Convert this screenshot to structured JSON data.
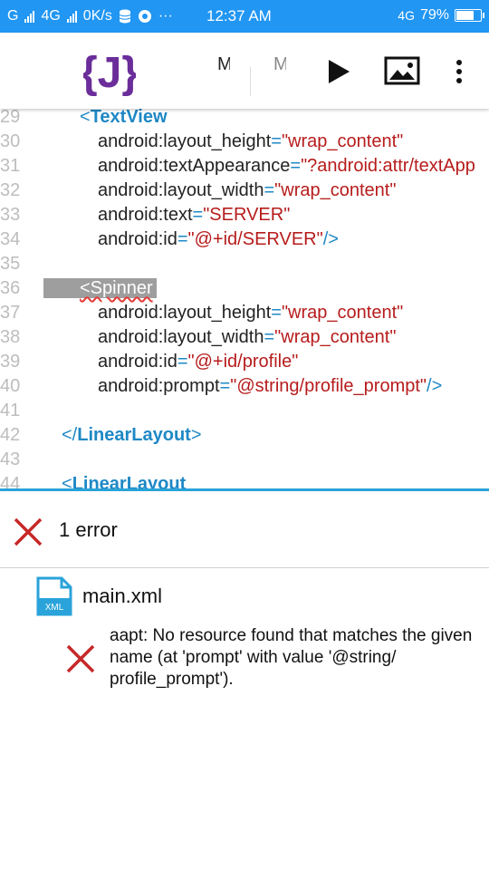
{
  "status_bar": {
    "sim1": "G",
    "sim2": "4G",
    "speed": "0K/s",
    "dots": "···",
    "time": "12:37 AM",
    "net_type": "4G",
    "battery": "79%",
    "battery_level": 0.79
  },
  "app_bar": {
    "logo_glyph": "{J}",
    "tab1": "MAIN",
    "tab2": "MAIN"
  },
  "editor": {
    "lines": [
      {
        "n": "29",
        "indent": 40,
        "parts": [
          [
            "punct",
            "<"
          ],
          [
            "tag",
            "TextView"
          ]
        ]
      },
      {
        "n": "30",
        "indent": 60,
        "parts": [
          [
            "attr",
            "android:layout_height"
          ],
          [
            "eq",
            "="
          ],
          [
            "val",
            "\"wrap_content\""
          ]
        ]
      },
      {
        "n": "31",
        "indent": 60,
        "parts": [
          [
            "attr",
            "android:textAppearance"
          ],
          [
            "eq",
            "="
          ],
          [
            "val",
            "\"?android:attr/textApp"
          ]
        ]
      },
      {
        "n": "32",
        "indent": 60,
        "parts": [
          [
            "attr",
            "android:layout_width"
          ],
          [
            "eq",
            "="
          ],
          [
            "val",
            "\"wrap_content\""
          ]
        ]
      },
      {
        "n": "33",
        "indent": 60,
        "parts": [
          [
            "attr",
            "android:text"
          ],
          [
            "eq",
            "="
          ],
          [
            "val",
            "\"SERVER\""
          ]
        ]
      },
      {
        "n": "34",
        "indent": 60,
        "parts": [
          [
            "attr",
            "android:id"
          ],
          [
            "eq",
            "="
          ],
          [
            "val",
            "\"@+id/SERVER\""
          ],
          [
            "punct",
            "/>"
          ]
        ]
      },
      {
        "n": "35",
        "indent": 0,
        "parts": []
      },
      {
        "n": "36",
        "indent": 0,
        "parts": [
          [
            "hl",
            "<Spinner"
          ]
        ]
      },
      {
        "n": "37",
        "indent": 60,
        "parts": [
          [
            "attr",
            "android:layout_height"
          ],
          [
            "eq",
            "="
          ],
          [
            "val",
            "\"wrap_content\""
          ]
        ]
      },
      {
        "n": "38",
        "indent": 60,
        "parts": [
          [
            "attr",
            "android:layout_width"
          ],
          [
            "eq",
            "="
          ],
          [
            "val",
            "\"wrap_content\""
          ]
        ]
      },
      {
        "n": "39",
        "indent": 60,
        "parts": [
          [
            "attr",
            "android:id"
          ],
          [
            "eq",
            "="
          ],
          [
            "val",
            "\"@+id/profile\""
          ]
        ]
      },
      {
        "n": "40",
        "indent": 60,
        "parts": [
          [
            "attr",
            "android:prompt"
          ],
          [
            "eq",
            "="
          ],
          [
            "val",
            "\"@string/profile_prompt\""
          ],
          [
            "punct",
            "/>"
          ]
        ]
      },
      {
        "n": "41",
        "indent": 0,
        "parts": []
      },
      {
        "n": "42",
        "indent": 20,
        "parts": [
          [
            "punct",
            "</"
          ],
          [
            "tag",
            "LinearLayout"
          ],
          [
            "punct",
            ">"
          ]
        ]
      },
      {
        "n": "43",
        "indent": 0,
        "parts": []
      },
      {
        "n": "44",
        "indent": 20,
        "parts": [
          [
            "punct",
            "<"
          ],
          [
            "tag",
            "LinearLayout"
          ]
        ]
      }
    ]
  },
  "errors": {
    "count_label": "1 error",
    "file": "main.xml",
    "file_badge": "XML",
    "message": "aapt: No resource found that matches the given name (at 'prompt' with value '@string/ profile_prompt')."
  },
  "colors": {
    "status_bar": "#2196f3",
    "logo": "#6a2d9a",
    "error_red": "#c62828",
    "file_icon": "#29a3d9",
    "tag": "#1e88c5",
    "value": "#b71c1c"
  }
}
